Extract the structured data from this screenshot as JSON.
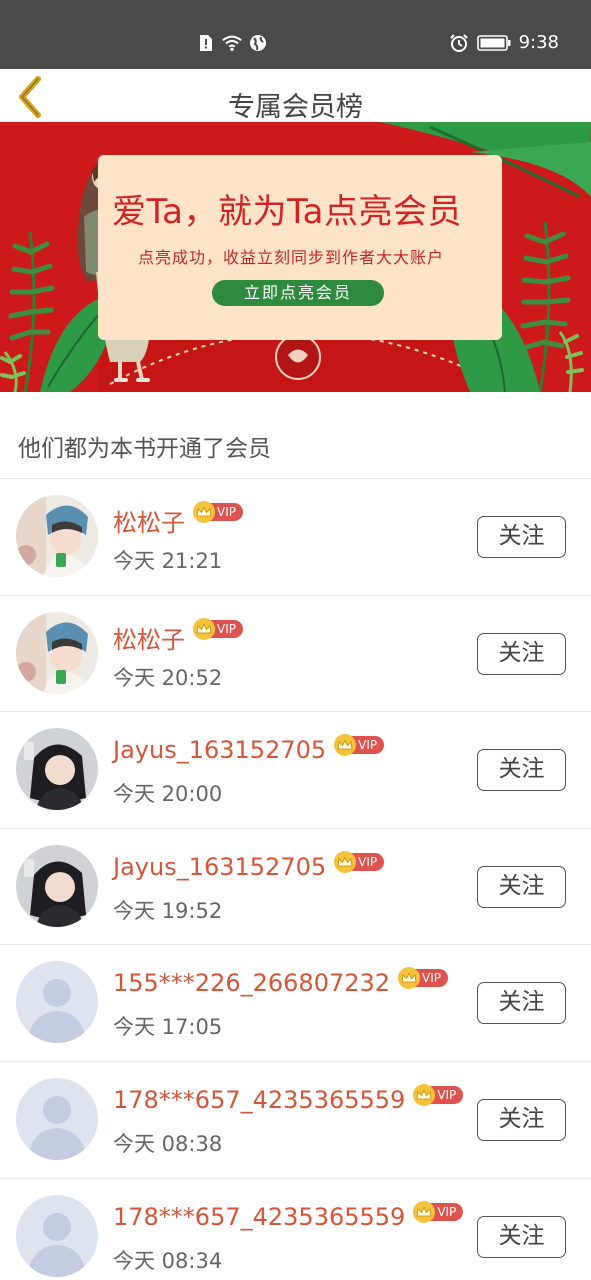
{
  "status_bar": {
    "time": "9:38"
  },
  "header": {
    "title": "专属会员榜"
  },
  "banner": {
    "headline": "爱Ta，就为Ta点亮会员",
    "subtitle": "点亮成功，收益立刻同步到作者大大账户",
    "cta": "立即点亮会员"
  },
  "section_title": "他们都为本书开通了会员",
  "vip_label": "VIP",
  "members": [
    {
      "name": "松松子",
      "time": "今天 21:21",
      "avatar": "photo-girl-cap",
      "follow": "关注"
    },
    {
      "name": "松松子",
      "time": "今天 20:52",
      "avatar": "photo-girl-cap",
      "follow": "关注"
    },
    {
      "name": "Jayus_163152705",
      "time": "今天 20:00",
      "avatar": "photo-girl-dark",
      "follow": "关注"
    },
    {
      "name": "Jayus_163152705",
      "time": "今天 19:52",
      "avatar": "photo-girl-dark",
      "follow": "关注"
    },
    {
      "name": "155***226_266807232",
      "time": "今天 17:05",
      "avatar": "default",
      "follow": "关注"
    },
    {
      "name": "178***657_4235365559",
      "time": "今天 08:38",
      "avatar": "default",
      "follow": "关注"
    },
    {
      "name": "178***657_4235365559",
      "time": "今天 08:34",
      "avatar": "default",
      "follow": "关注"
    }
  ],
  "colors": {
    "status_bar": "#4a4a4a",
    "banner_red": "#cc1a1a",
    "name_color": "#d65638",
    "vip_tag": "#e0524d",
    "crown": "#f5c23c",
    "back_arrow": "#d6a21d"
  }
}
